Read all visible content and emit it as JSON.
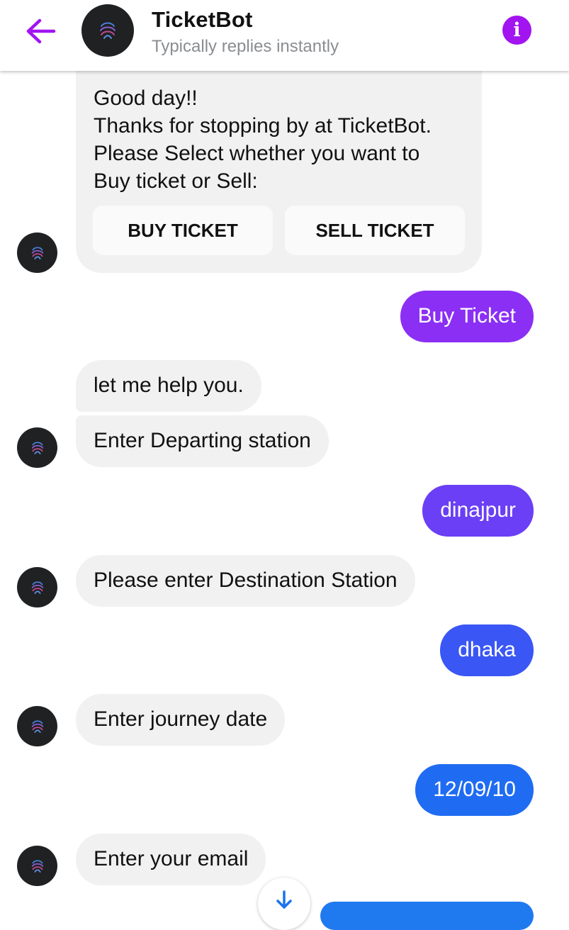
{
  "colors": {
    "accent": "#a214f0",
    "incoming_bubble": "#f1f1f1",
    "outgoing_gradient": [
      "#8b2ff5",
      "#6a3ff5",
      "#4f4ff5",
      "#2f5ff5",
      "#1a73f0"
    ]
  },
  "header": {
    "back_icon": "arrow-left-icon",
    "title": "TicketBot",
    "subtitle": "Typically replies instantly",
    "info_icon": "info-icon"
  },
  "welcome_card": {
    "lines": [
      "Good day!!",
      "Thanks for stopping by at TicketBot.",
      "Please Select whether you want to",
      "Buy ticket or Sell:"
    ],
    "buttons": [
      "BUY TICKET",
      "SELL TICKET"
    ]
  },
  "messages": [
    {
      "from": "user",
      "text": "Buy Ticket"
    },
    {
      "from": "bot",
      "text": "let me help you."
    },
    {
      "from": "bot",
      "text": "Enter Departing station"
    },
    {
      "from": "user",
      "text": "dinajpur"
    },
    {
      "from": "bot",
      "text": "Please enter Destination Station"
    },
    {
      "from": "user",
      "text": "dhaka"
    },
    {
      "from": "bot",
      "text": "Enter journey date"
    },
    {
      "from": "user",
      "text": "12/09/10"
    },
    {
      "from": "bot",
      "text": "Enter your email"
    }
  ],
  "scroll_down_icon": "arrow-down-icon"
}
